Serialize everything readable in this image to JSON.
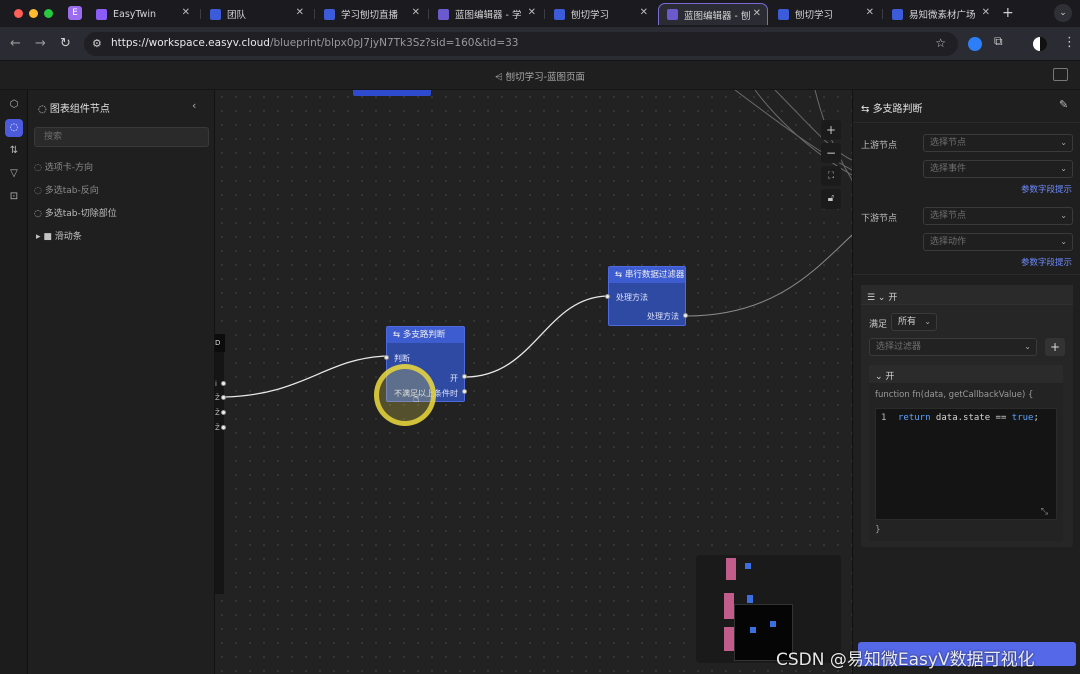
{
  "browser": {
    "tabs": [
      {
        "title": "EasyTwin",
        "favicon_color": "#8b5cf6"
      },
      {
        "title": "团队",
        "favicon_color": "#3b5bdb"
      },
      {
        "title": "学习刨切直播",
        "favicon_color": "#3b5bdb"
      },
      {
        "title": "蓝图编辑器 - 学",
        "favicon_color": "#6a5acd"
      },
      {
        "title": "刨切学习",
        "favicon_color": "#3b5bdb"
      },
      {
        "title": "蓝图编辑器 - 刨",
        "favicon_color": "#6a5acd",
        "active": true
      },
      {
        "title": "刨切学习",
        "favicon_color": "#3b5bdb"
      },
      {
        "title": "易知微素材广场",
        "favicon_color": "#3b5bdb"
      }
    ],
    "url_host": "https://workspace.easyv.cloud",
    "url_path": "/blueprint/blpx0pJ7jyN7Tk3Sz?sid=160&tid=33",
    "first_tab_letter": "E"
  },
  "app": {
    "breadcrumb": "刨切学习-蓝图页面"
  },
  "left_panel": {
    "title": "图表组件节点",
    "search_placeholder": "搜索",
    "items": [
      {
        "label": "选项卡-方向"
      },
      {
        "label": "多选tab-反向"
      },
      {
        "label": "多选tab-切除部位"
      }
    ],
    "folder": "滑动条"
  },
  "canvas": {
    "stub_tag": "D",
    "node_multi": {
      "title": "多支路判断",
      "in_port": "判断",
      "out_on": "开",
      "out_else": "不满足以上条件时"
    },
    "node_filter": {
      "title": "串行数据过滤器",
      "in_port": "处理方法",
      "out_port": "处理方法"
    },
    "stub_labels": [
      "i",
      "Ž",
      "Ž",
      "Ž"
    ]
  },
  "inspector": {
    "title": "多支路判断",
    "upstream_label": "上游节点",
    "upstream_node_placeholder": "选择节点",
    "upstream_event_placeholder": "选择事件",
    "param_hint_1": "参数字段提示",
    "downstream_label": "下游节点",
    "downstream_node_placeholder": "选择节点",
    "downstream_action_placeholder": "选择动作",
    "param_hint_2": "参数字段提示",
    "branch_title": "开",
    "satisfy_label": "满足",
    "satisfy_value": "所有",
    "filter_placeholder": "选择过滤器",
    "sub_title": "开",
    "fn_signature": "function fn(data, getCallbackValue) {",
    "code_line_no": "1",
    "code_kw": "return",
    "code_rest": " data.state == ",
    "code_kw2": "true",
    "code_end": ";",
    "closing_brace": "}"
  },
  "watermark": "CSDN @易知微EasyV数据可视化"
}
